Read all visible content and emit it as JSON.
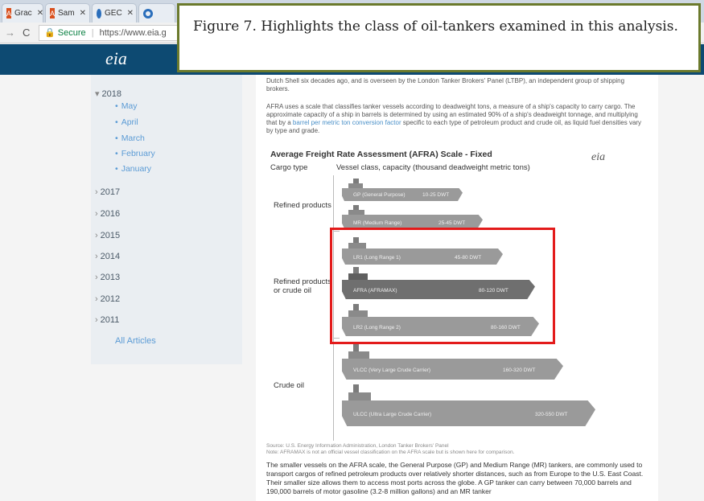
{
  "browser": {
    "tabs": [
      {
        "label": "Grac",
        "favicon": "red-square-icon"
      },
      {
        "label": "Sam",
        "favicon": "red-square-icon"
      },
      {
        "label": "GEC",
        "favicon": "ring-icon"
      },
      {
        "label": "",
        "favicon": "ring-icon"
      }
    ],
    "url_secure_label": "Secure",
    "url": "https://www.eia.g"
  },
  "site": {
    "logo_text": "eia"
  },
  "sidebar": {
    "years": [
      {
        "label": "2018",
        "expanded": true
      },
      {
        "label": "2017",
        "expanded": false
      },
      {
        "label": "2016",
        "expanded": false
      },
      {
        "label": "2015",
        "expanded": false
      },
      {
        "label": "2014",
        "expanded": false
      },
      {
        "label": "2013",
        "expanded": false
      },
      {
        "label": "2012",
        "expanded": false
      },
      {
        "label": "2011",
        "expanded": false
      }
    ],
    "months": [
      "May",
      "April",
      "March",
      "February",
      "January"
    ],
    "all_articles": "All Articles"
  },
  "article": {
    "intro_para": "Dutch Shell six decades ago, and is overseen by the London Tanker Brokers' Panel (LTBP), an independent group of shipping brokers.",
    "afra_para_a": "AFRA uses a scale that classifies tanker vessels according to deadweight tons, a measure of a ship's capacity to carry cargo. The approximate capacity of a ship in barrels is determined by using an estimated 90% of a ship's deadweight tonnage, and multiplying that by a",
    "afra_para_link": "barrel per metric ton conversion factor",
    "afra_para_b": "specific to each type of petroleum product and crude oil, as liquid fuel densities vary by type and grade.",
    "chart_title": "Average Freight Rate Assessment (AFRA) Scale - Fixed",
    "col_cargo": "Cargo type",
    "col_vessel": "Vessel class, capacity (thousand deadweight metric tons)",
    "chart_logo": "eia",
    "group_refined": "Refined products",
    "group_refined_crude_1": "Refined products",
    "group_refined_crude_2": "or crude oil",
    "group_crude": "Crude oil",
    "ships": [
      {
        "name": "GP (General Purpose)",
        "capacity": "10-25 DWT"
      },
      {
        "name": "MR (Medium Range)",
        "capacity": "25-45 DWT"
      },
      {
        "name": "LR1 (Long Range 1)",
        "capacity": "45-80 DWT"
      },
      {
        "name": "AFRA (AFRAMAX)",
        "capacity": "80-120 DWT"
      },
      {
        "name": "LR2 (Long Range 2)",
        "capacity": "80-160 DWT"
      },
      {
        "name": "VLCC (Very Large Crude Carrier)",
        "capacity": "160-320 DWT"
      },
      {
        "name": "ULCC (Ultra Large Crude Carrier)",
        "capacity": "320-550 DWT"
      }
    ],
    "source_line": "Source: U.S. Energy Information Administration, London Tanker Brokers' Panel",
    "note_line": "Note: AFRAMAX is not an official vessel classification on the AFRA scale but is shown here for comparison.",
    "bottom_para": "The smaller vessels on the AFRA scale, the General Purpose (GP) and Medium Range (MR) tankers, are commonly used to transport cargos of refined petroleum products over relatively shorter distances, such as from Europe to the U.S. East Coast. Their smaller size allows them to access most ports across the globe. A GP tanker can carry between 70,000 barrels and 190,000 barrels of motor gasoline (3.2-8 million gallons) and an MR tanker"
  },
  "caption": {
    "text": "Figure 7. Highlights the class of oil-tankers examined in this analysis."
  },
  "colors": {
    "header": "#0d4a72",
    "highlight": "#e31b1b",
    "caption_border": "#6b7a2c",
    "link": "#5b9bd5"
  }
}
